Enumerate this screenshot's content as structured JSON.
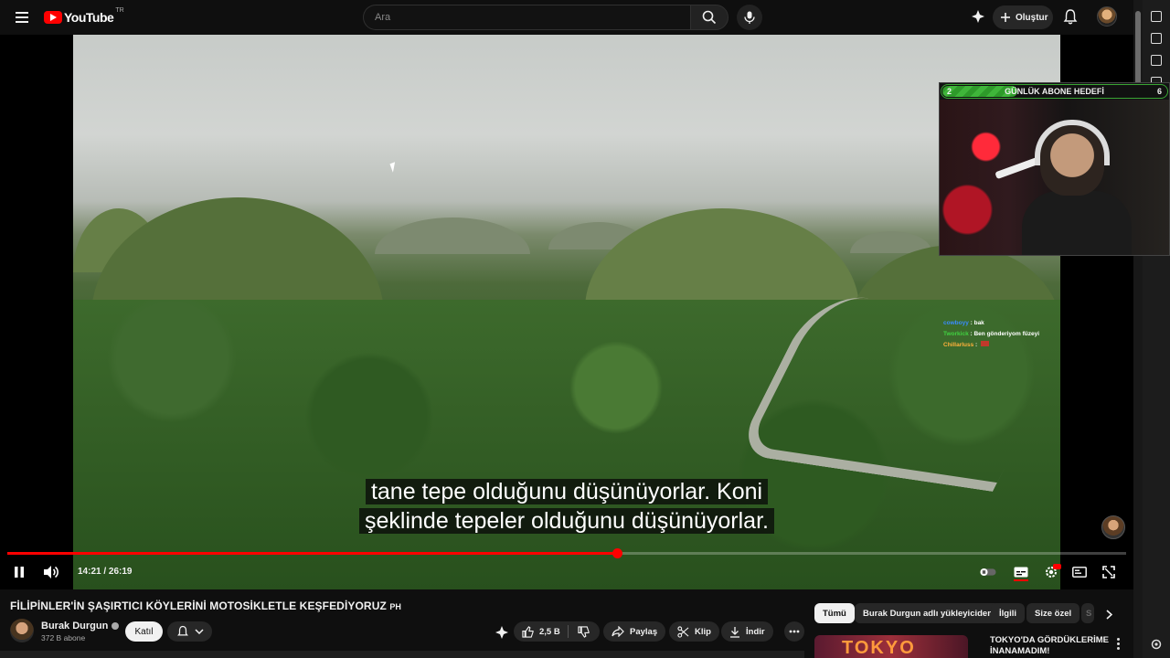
{
  "topbar": {
    "logo_text": "YouTube",
    "logo_region": "TR",
    "search_placeholder": "Ara",
    "create_label": "Oluştur"
  },
  "player": {
    "subtitle_line1": "tane tepe olduğunu düşünüyorlar. Koni",
    "subtitle_line2": "şeklinde tepeler olduğunu düşünüyorlar.",
    "current_time": "14:21",
    "separator": " / ",
    "duration": "26:19",
    "progress_fraction": 0.5453
  },
  "overlay": {
    "goal_label": "GÜNLÜK ABONE HEDEFİ",
    "goal_current": "2",
    "goal_target": "6",
    "goal_fraction": 0.33,
    "chat": [
      {
        "name": "cowboyy",
        "message": "bak"
      },
      {
        "name": "Tworkick",
        "message": "Ben gönderiyom füzeyi"
      },
      {
        "name": "Chillarluss",
        "message": ""
      }
    ]
  },
  "video": {
    "title": "FİLİPİNLER'İN ŞAŞIRTICI KÖYLERİNİ MOTOSİKLETLE KEŞFEDİYORUZ",
    "title_flag": "PH",
    "channel": "Burak Durgun",
    "subscribers": "372 B abone",
    "join_label": "Katıl",
    "likes": "2,5 B",
    "share_label": "Paylaş",
    "clip_label": "Klip",
    "download_label": "İndir"
  },
  "related": {
    "chips": [
      "Tümü",
      "Burak Durgun adlı yükleyiciden",
      "İlgili",
      "Size özel",
      "S"
    ],
    "first_title": "TOKYO'DA GÖRDÜKLERİME İNANAMADIM!",
    "first_thumb_text": "TOKYO"
  },
  "colors": {
    "accent": "#ff0000",
    "background": "#0f0f0f",
    "pill": "#272727",
    "goal_green": "#3aa534"
  }
}
